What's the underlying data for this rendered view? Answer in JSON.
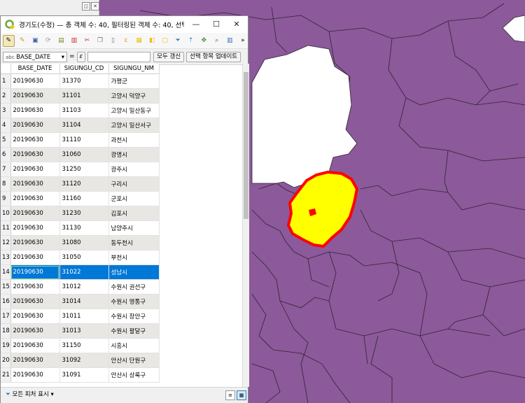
{
  "window": {
    "title": "경기도(수정) — 총 객체 수: 40, 필터링된 객체 수: 40, 선택...",
    "minimize_label": "—",
    "maximize_label": "☐",
    "close_label": "✕"
  },
  "toolbar": {
    "icons": [
      "toggle-edit-icon",
      "multi-edit-icon",
      "save-edits-icon",
      "reload-icon",
      "add-feature-icon",
      "delete-feature-icon",
      "cut-icon",
      "copy-icon",
      "paste-icon",
      "select-expression-icon",
      "select-all-icon",
      "invert-selection-icon",
      "deselect-icon",
      "filter-icon",
      "move-selection-top-icon",
      "pan-to-selection-icon",
      "zoom-to-selection-icon",
      "new-field-icon"
    ],
    "overflow_label": "»"
  },
  "filter_bar": {
    "field_type": "abc",
    "field_name": "BASE_DATE",
    "equals_label": "=",
    "epsilon_label": "ε",
    "expression_value": "",
    "update_all_label": "모두 갱신",
    "update_selected_label": "선택 항목 업데이트"
  },
  "table": {
    "columns": [
      "BASE_DATE",
      "SIGUNGU_CD",
      "SIGUNGU_NM"
    ],
    "selected_row": 14,
    "rows": [
      {
        "n": "1",
        "date": "20190630",
        "cd": "31370",
        "nm": "가평군"
      },
      {
        "n": "2",
        "date": "20190630",
        "cd": "31101",
        "nm": "고양시 덕양구"
      },
      {
        "n": "3",
        "date": "20190630",
        "cd": "31103",
        "nm": "고양시 일산동구"
      },
      {
        "n": "4",
        "date": "20190630",
        "cd": "31104",
        "nm": "고양시 일산서구"
      },
      {
        "n": "5",
        "date": "20190630",
        "cd": "31110",
        "nm": "과천시"
      },
      {
        "n": "6",
        "date": "20190630",
        "cd": "31060",
        "nm": "광명시"
      },
      {
        "n": "7",
        "date": "20190630",
        "cd": "31250",
        "nm": "광주시"
      },
      {
        "n": "8",
        "date": "20190630",
        "cd": "31120",
        "nm": "구리시"
      },
      {
        "n": "9",
        "date": "20190630",
        "cd": "31160",
        "nm": "군포시"
      },
      {
        "n": "10",
        "date": "20190630",
        "cd": "31230",
        "nm": "김포시"
      },
      {
        "n": "11",
        "date": "20190630",
        "cd": "31130",
        "nm": "남양주시"
      },
      {
        "n": "12",
        "date": "20190630",
        "cd": "31080",
        "nm": "동두천시"
      },
      {
        "n": "13",
        "date": "20190630",
        "cd": "31050",
        "nm": "부천시"
      },
      {
        "n": "14",
        "date": "20190630",
        "cd": "31022",
        "nm": "성남시"
      },
      {
        "n": "15",
        "date": "20190630",
        "cd": "31012",
        "nm": "수원시 권선구"
      },
      {
        "n": "16",
        "date": "20190630",
        "cd": "31014",
        "nm": "수원시 영통구"
      },
      {
        "n": "17",
        "date": "20190630",
        "cd": "31011",
        "nm": "수원시 장안구"
      },
      {
        "n": "18",
        "date": "20190630",
        "cd": "31013",
        "nm": "수원시 팔달구"
      },
      {
        "n": "19",
        "date": "20190630",
        "cd": "31150",
        "nm": "시흥시"
      },
      {
        "n": "20",
        "date": "20190630",
        "cd": "31092",
        "nm": "안산시 단원구"
      },
      {
        "n": "21",
        "date": "20190630",
        "cd": "31091",
        "nm": "안산시 상록구"
      }
    ]
  },
  "bottom_bar": {
    "show_features_label": "모든 피처 표시",
    "form_view_icon": "form-view-icon",
    "table_view_icon": "table-view-icon"
  },
  "dock": {
    "float_label": "◫",
    "close_label": "✕"
  },
  "colors": {
    "map_fill": "#8c599a",
    "map_border": "#2f2333",
    "selection_fill": "#ffff00",
    "selection_outline": "#ff0000",
    "row_highlight": "#0078d7",
    "alt_row": "#e9e7e3"
  }
}
